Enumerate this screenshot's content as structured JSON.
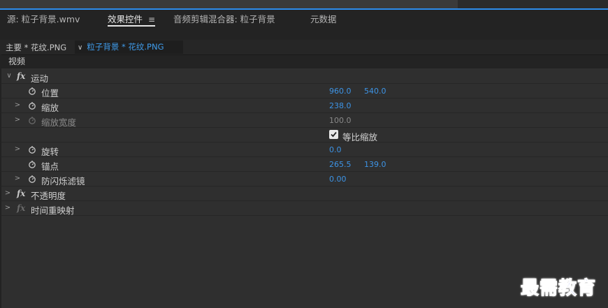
{
  "panel_tabs": [
    {
      "label": "源: 粒子背景.wmv",
      "active": false
    },
    {
      "label": "效果控件",
      "active": true,
      "menu": "≡"
    },
    {
      "label": "音频剪辑混合器: 粒子背景",
      "active": false
    },
    {
      "label": "元数据",
      "active": false
    }
  ],
  "sequence": {
    "master_label": "主要 * 花纹.PNG",
    "clip_label": "粒子背景 * 花纹.PNG",
    "clip_chevron": "∨"
  },
  "section": {
    "video": "视频"
  },
  "effects": {
    "motion": {
      "label": "运动"
    },
    "opacity": {
      "label": "不透明度"
    },
    "time_remap": {
      "label": "时间重映射"
    },
    "fx_glyph": "fx"
  },
  "properties": {
    "position": {
      "label": "位置",
      "x": "960.0",
      "y": "540.0"
    },
    "scale": {
      "label": "缩放",
      "value": "238.0"
    },
    "scale_width": {
      "label": "缩放宽度",
      "value": "100.0"
    },
    "uniform_scale": {
      "label": "等比缩放",
      "checked": true
    },
    "rotation": {
      "label": "旋转",
      "value": "0.0"
    },
    "anchor": {
      "label": "锚点",
      "x": "265.5",
      "y": "139.0"
    },
    "anti_flicker": {
      "label": "防闪烁滤镜",
      "value": "0.00"
    }
  },
  "twirl": {
    "open": "∨",
    "closed": ">"
  },
  "watermark": "最需教育",
  "colors": {
    "accent": "#3d94e6",
    "panel": "#2f2f2f",
    "background": "#232323"
  }
}
